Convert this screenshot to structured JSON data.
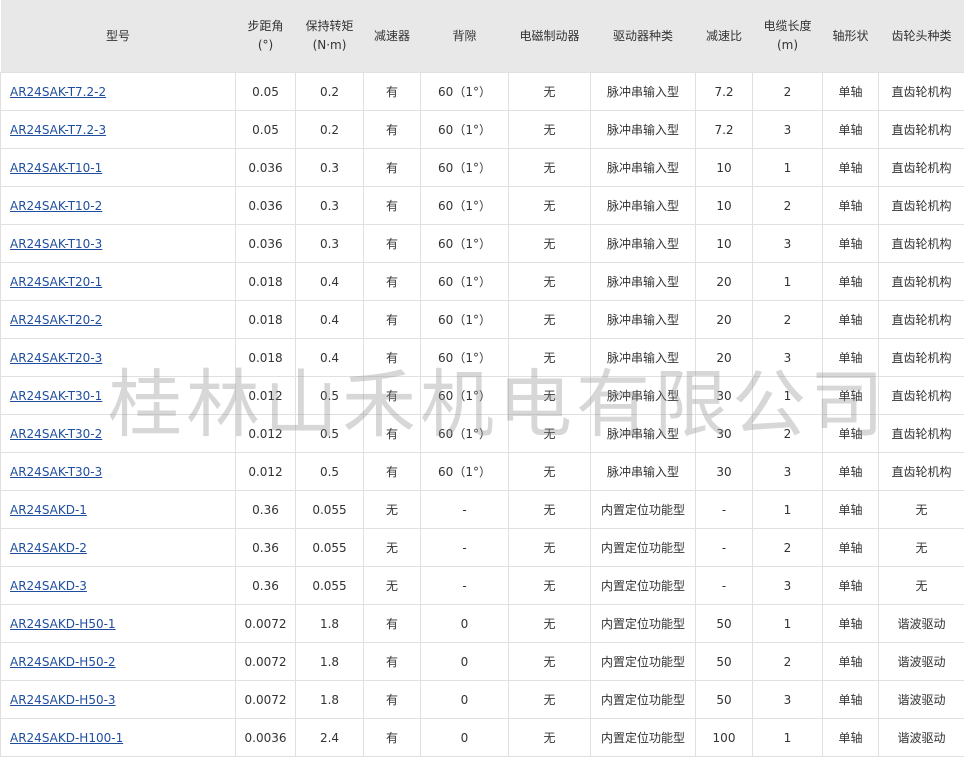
{
  "watermark": "桂林山禾机电有限公司",
  "colors": {
    "header_bg": "#e8e8e8",
    "link": "#1f4e9e",
    "border": "#e0e0e0"
  },
  "headers": [
    {
      "line1": "型号",
      "line2": ""
    },
    {
      "line1": "步距角",
      "line2": "(°)"
    },
    {
      "line1": "保持转矩",
      "line2": "(N·m)"
    },
    {
      "line1": "减速器",
      "line2": ""
    },
    {
      "line1": "背隙",
      "line2": ""
    },
    {
      "line1": "电磁制动器",
      "line2": ""
    },
    {
      "line1": "驱动器种类",
      "line2": ""
    },
    {
      "line1": "减速比",
      "line2": ""
    },
    {
      "line1": "电缆长度",
      "line2": "(m)"
    },
    {
      "line1": "轴形状",
      "line2": ""
    },
    {
      "line1": "齿轮头种类",
      "line2": ""
    }
  ],
  "rows": [
    [
      "AR24SAK-T7.2-2",
      "0.05",
      "0.2",
      "有",
      "60（1°）",
      "无",
      "脉冲串输入型",
      "7.2",
      "2",
      "单轴",
      "直齿轮机构"
    ],
    [
      "AR24SAK-T7.2-3",
      "0.05",
      "0.2",
      "有",
      "60（1°）",
      "无",
      "脉冲串输入型",
      "7.2",
      "3",
      "单轴",
      "直齿轮机构"
    ],
    [
      "AR24SAK-T10-1",
      "0.036",
      "0.3",
      "有",
      "60（1°）",
      "无",
      "脉冲串输入型",
      "10",
      "1",
      "单轴",
      "直齿轮机构"
    ],
    [
      "AR24SAK-T10-2",
      "0.036",
      "0.3",
      "有",
      "60（1°）",
      "无",
      "脉冲串输入型",
      "10",
      "2",
      "单轴",
      "直齿轮机构"
    ],
    [
      "AR24SAK-T10-3",
      "0.036",
      "0.3",
      "有",
      "60（1°）",
      "无",
      "脉冲串输入型",
      "10",
      "3",
      "单轴",
      "直齿轮机构"
    ],
    [
      "AR24SAK-T20-1",
      "0.018",
      "0.4",
      "有",
      "60（1°）",
      "无",
      "脉冲串输入型",
      "20",
      "1",
      "单轴",
      "直齿轮机构"
    ],
    [
      "AR24SAK-T20-2",
      "0.018",
      "0.4",
      "有",
      "60（1°）",
      "无",
      "脉冲串输入型",
      "20",
      "2",
      "单轴",
      "直齿轮机构"
    ],
    [
      "AR24SAK-T20-3",
      "0.018",
      "0.4",
      "有",
      "60（1°）",
      "无",
      "脉冲串输入型",
      "20",
      "3",
      "单轴",
      "直齿轮机构"
    ],
    [
      "AR24SAK-T30-1",
      "0.012",
      "0.5",
      "有",
      "60（1°）",
      "无",
      "脉冲串输入型",
      "30",
      "1",
      "单轴",
      "直齿轮机构"
    ],
    [
      "AR24SAK-T30-2",
      "0.012",
      "0.5",
      "有",
      "60（1°）",
      "无",
      "脉冲串输入型",
      "30",
      "2",
      "单轴",
      "直齿轮机构"
    ],
    [
      "AR24SAK-T30-3",
      "0.012",
      "0.5",
      "有",
      "60（1°）",
      "无",
      "脉冲串输入型",
      "30",
      "3",
      "单轴",
      "直齿轮机构"
    ],
    [
      "AR24SAKD-1",
      "0.36",
      "0.055",
      "无",
      "-",
      "无",
      "内置定位功能型",
      "-",
      "1",
      "单轴",
      "无"
    ],
    [
      "AR24SAKD-2",
      "0.36",
      "0.055",
      "无",
      "-",
      "无",
      "内置定位功能型",
      "-",
      "2",
      "单轴",
      "无"
    ],
    [
      "AR24SAKD-3",
      "0.36",
      "0.055",
      "无",
      "-",
      "无",
      "内置定位功能型",
      "-",
      "3",
      "单轴",
      "无"
    ],
    [
      "AR24SAKD-H50-1",
      "0.0072",
      "1.8",
      "有",
      "0",
      "无",
      "内置定位功能型",
      "50",
      "1",
      "单轴",
      "谐波驱动"
    ],
    [
      "AR24SAKD-H50-2",
      "0.0072",
      "1.8",
      "有",
      "0",
      "无",
      "内置定位功能型",
      "50",
      "2",
      "单轴",
      "谐波驱动"
    ],
    [
      "AR24SAKD-H50-3",
      "0.0072",
      "1.8",
      "有",
      "0",
      "无",
      "内置定位功能型",
      "50",
      "3",
      "单轴",
      "谐波驱动"
    ],
    [
      "AR24SAKD-H100-1",
      "0.0036",
      "2.4",
      "有",
      "0",
      "无",
      "内置定位功能型",
      "100",
      "1",
      "单轴",
      "谐波驱动"
    ]
  ]
}
